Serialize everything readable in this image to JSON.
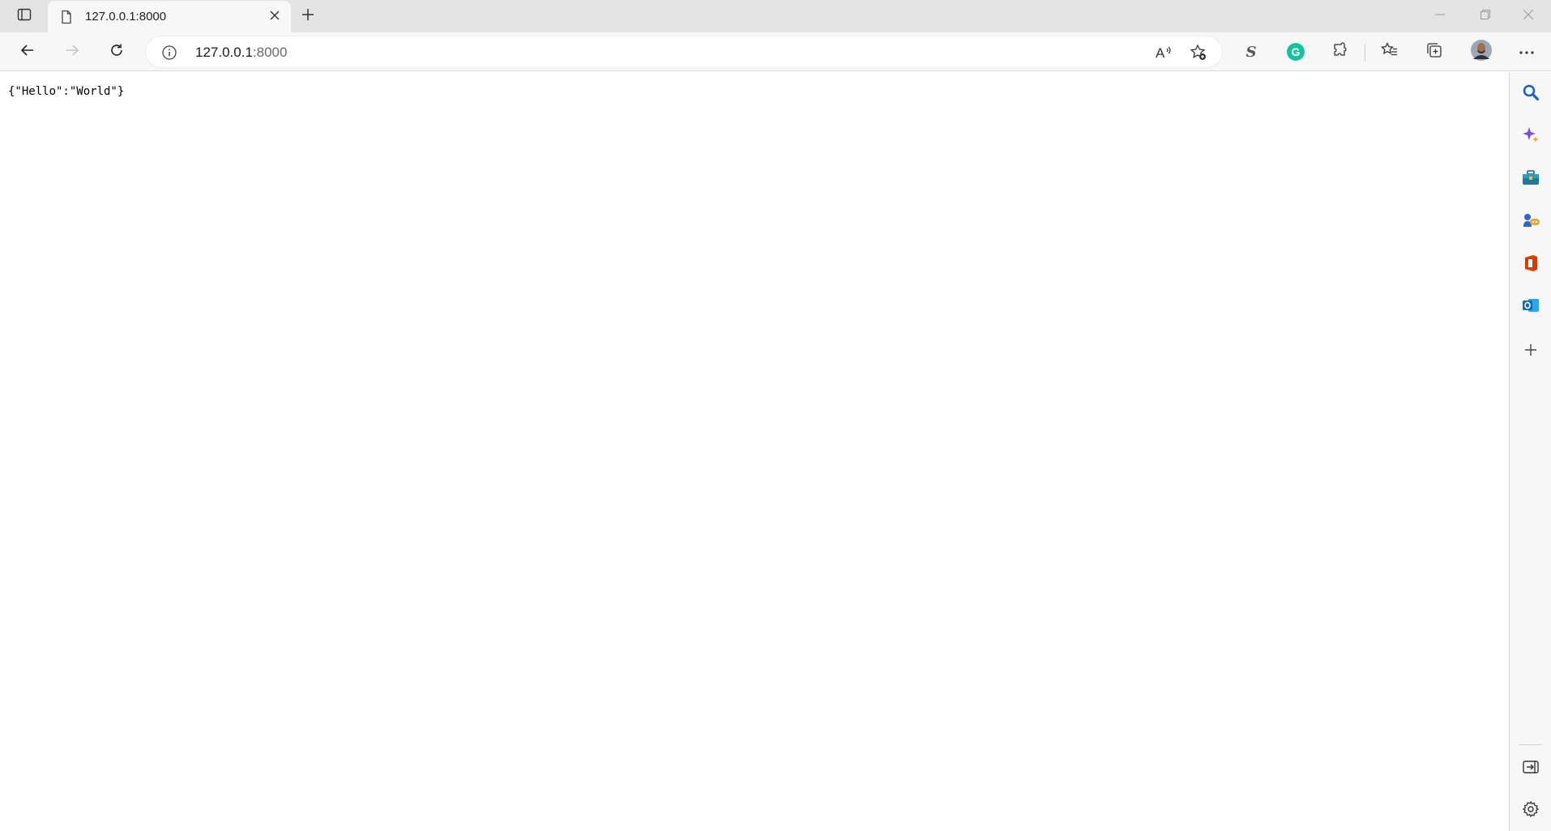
{
  "browser": {
    "tab": {
      "title": "127.0.0.1:8000",
      "favicon": "page-icon"
    },
    "tab_actions_icon": "tab-actions-icon",
    "new_tab_icon": "plus-icon",
    "window_controls": [
      "minimize-icon",
      "restore-icon",
      "close-icon"
    ]
  },
  "toolbar": {
    "nav_icons": [
      "back-arrow-icon",
      "forward-arrow-icon",
      "refresh-icon"
    ],
    "address": {
      "host": "127.0.0.1",
      "port": ":8000",
      "site_info_icon": "info-icon"
    },
    "address_actions": [
      "read-aloud-icon",
      "add-favorite-icon"
    ],
    "extensions": [
      {
        "name": "s-extension-icon",
        "label": "S"
      },
      {
        "name": "grammarly-icon",
        "label": "G",
        "color": "#15c39a"
      },
      {
        "name": "extensions-icon"
      }
    ],
    "right_actions": [
      "favorites-icon",
      "collections-icon",
      "profile-avatar",
      "settings-more-icon"
    ]
  },
  "page": {
    "body_text": "{\"Hello\":\"World\"}"
  },
  "sidebar": {
    "items": [
      "search-icon",
      "copilot-icon",
      "tools-icon",
      "games-icon",
      "office-icon",
      "outlook-icon",
      "add-icon"
    ],
    "bottom": [
      "hide-sidebar-icon",
      "sidebar-settings-icon"
    ],
    "colors": {
      "search": "#1a5fd0",
      "copilot": "#7b4ee0",
      "office": "#d83b01",
      "outlook": "#0f6cbd"
    }
  }
}
